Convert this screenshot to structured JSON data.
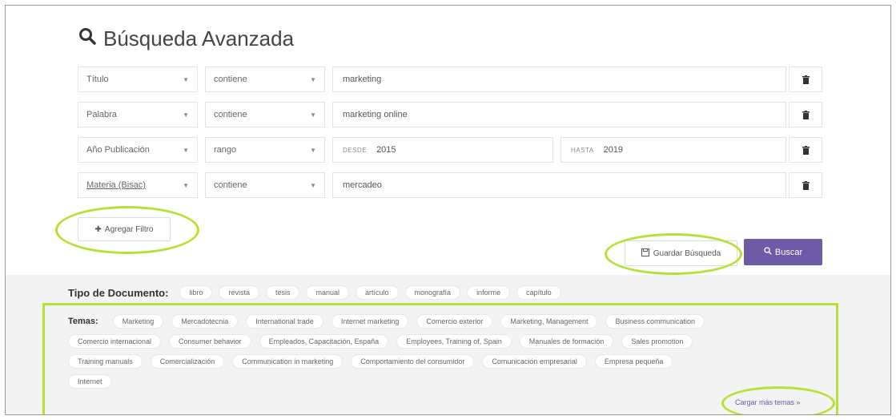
{
  "title": "Búsqueda Avanzada",
  "filters": [
    {
      "field": "Título",
      "operator": "contiene",
      "value": "marketing"
    },
    {
      "field": "Palabra",
      "operator": "contiene",
      "value": "marketing online"
    },
    {
      "field": "Año Publicación",
      "operator": "rango",
      "from_label": "DESDE",
      "from_value": "2015",
      "to_label": "HASTA",
      "to_value": "2019"
    },
    {
      "field": "Materia (Bisac)",
      "operator": "contiene",
      "value": "mercadeo"
    }
  ],
  "buttons": {
    "add_filter": "Agregar Filtro",
    "save_search": "Guardar Búsqueda",
    "search": "Buscar"
  },
  "doc_types": {
    "label": "Tipo de Documento:",
    "items": [
      "libro",
      "revista",
      "tesis",
      "manual",
      "artículo",
      "monografía",
      "informe",
      "capítulo"
    ]
  },
  "temas": {
    "label": "Temas:",
    "rows": [
      [
        "Marketing",
        "Mercadotecnia",
        "International trade",
        "Internet marketing",
        "Comercio exterior",
        "Marketing, Management",
        "Business communication"
      ],
      [
        "Comercio internacional",
        "Consumer behavior",
        "Empleados, Capacitación, España",
        "Employees, Training of, Spain",
        "Manuales de formación",
        "Sales promotion"
      ],
      [
        "Training manuals",
        "Comercialización",
        "Communication in marketing",
        "Comportamiento del consumidor",
        "Comunicación empresarial",
        "Empresa pequeña"
      ],
      [
        "Internet"
      ]
    ],
    "more_link": "Cargar más temas »"
  },
  "colors": {
    "accent": "#6e5aa6",
    "highlight": "#b7e035",
    "panel": "#f3f3f3"
  }
}
